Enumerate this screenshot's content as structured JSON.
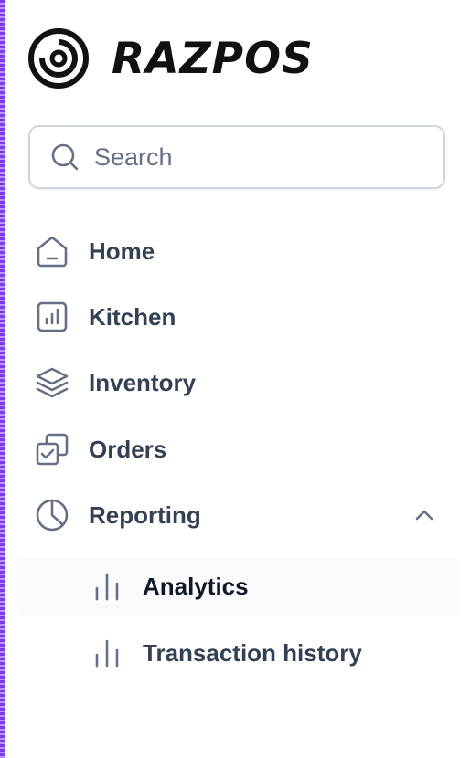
{
  "brand": {
    "name": "RAZPOS"
  },
  "search": {
    "placeholder": "Search"
  },
  "nav": {
    "items": [
      {
        "label": "Home",
        "icon": "home-icon"
      },
      {
        "label": "Kitchen",
        "icon": "bar-chart-square-icon"
      },
      {
        "label": "Inventory",
        "icon": "layers-icon"
      },
      {
        "label": "Orders",
        "icon": "check-copy-icon"
      },
      {
        "label": "Reporting",
        "icon": "pie-chart-icon",
        "expanded": true
      }
    ],
    "sub_items": [
      {
        "label": "Analytics",
        "icon": "bar-chart-icon",
        "active": true
      },
      {
        "label": "Transaction history",
        "icon": "bar-chart-icon",
        "active": false
      }
    ]
  },
  "colors": {
    "accent_edge": "#7c3aed",
    "text": "#344054",
    "active_bg": "#f9fafb"
  }
}
